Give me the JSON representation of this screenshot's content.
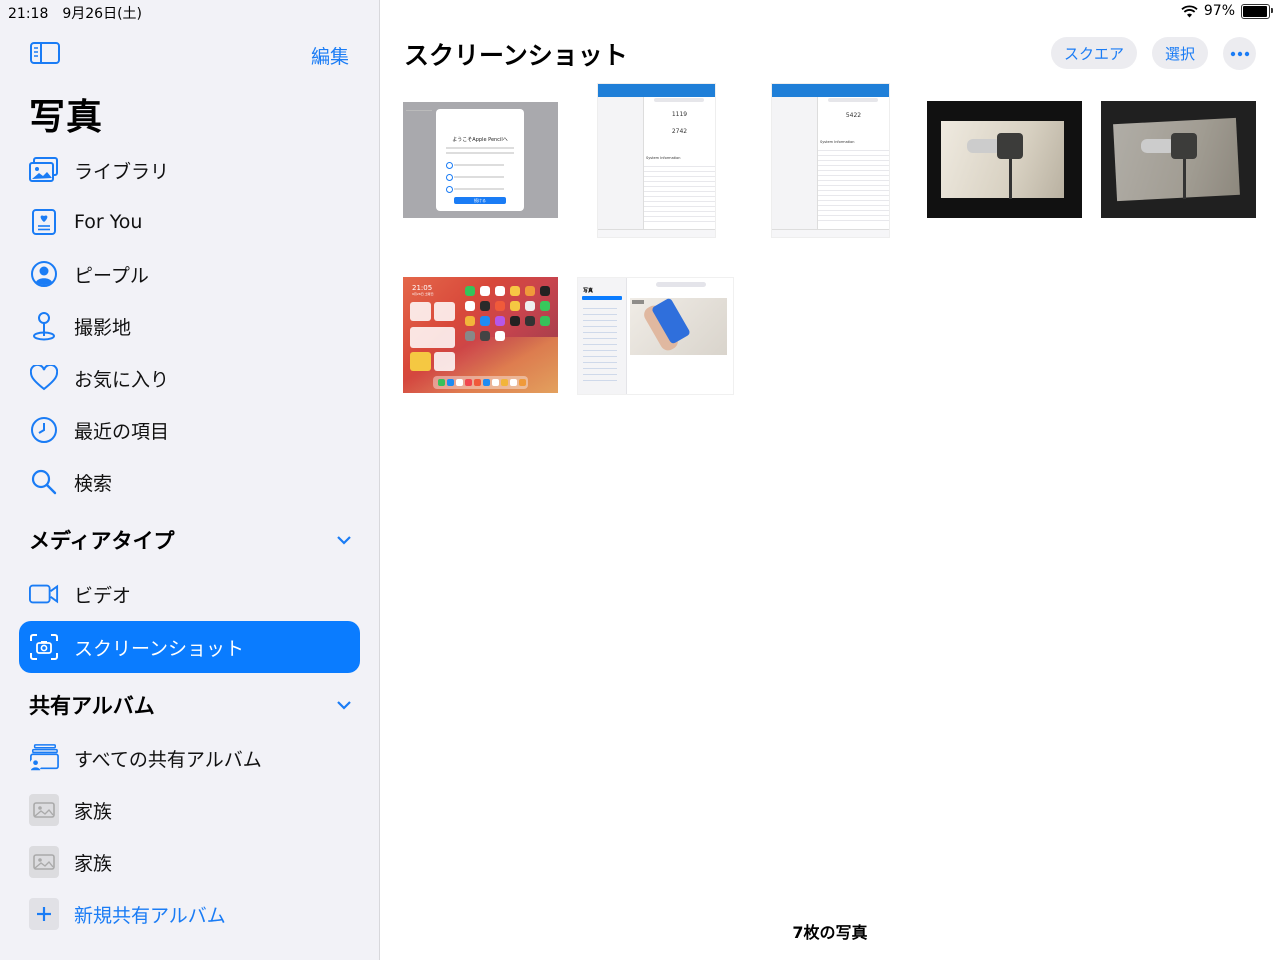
{
  "status_bar": {
    "time_date": "21:18　9月26日(土)",
    "battery_percent": "97%",
    "battery_level": 0.97
  },
  "sidebar": {
    "edit_label": "編集",
    "title": "写真",
    "items": [
      {
        "label": "ライブラリ",
        "icon": "library-icon"
      },
      {
        "label": "For You",
        "icon": "for-you-icon"
      },
      {
        "label": "ピープル",
        "icon": "people-icon"
      },
      {
        "label": "撮影地",
        "icon": "places-icon"
      },
      {
        "label": "お気に入り",
        "icon": "heart-icon"
      },
      {
        "label": "最近の項目",
        "icon": "clock-icon"
      },
      {
        "label": "検索",
        "icon": "search-icon"
      }
    ],
    "media_types": {
      "heading": "メディアタイプ",
      "items": [
        {
          "label": "ビデオ",
          "icon": "video-icon"
        },
        {
          "label": "スクリーンショット",
          "icon": "screenshot-icon",
          "selected": true
        }
      ]
    },
    "shared_albums": {
      "heading": "共有アルバム",
      "items": [
        {
          "label": "すべての共有アルバム",
          "icon": "shared-albums-icon"
        },
        {
          "label": "家族",
          "icon": "album-thumb-icon"
        },
        {
          "label": "家族",
          "icon": "album-thumb-icon"
        },
        {
          "label": "新規共有アルバム",
          "icon": "plus-icon"
        }
      ]
    }
  },
  "main": {
    "title": "スクリーンショット",
    "square_label": "スクエア",
    "select_label": "選択",
    "photo_count": "7枚の写真",
    "photos": {
      "p1": {
        "heading": "ようこそApple Pencilへ",
        "button": "続ける"
      },
      "p2": {
        "score_single": "1119",
        "score_multi": "2742",
        "section": "System Information"
      },
      "p3": {
        "score": "5422",
        "section": "System Information"
      },
      "p6": {
        "time": "21:05",
        "date": "9月26日 土曜日"
      },
      "p7": {
        "title": "写真"
      }
    }
  },
  "colors": {
    "accent": "#0a7cff",
    "sidebar_bg": "#f2f2f7",
    "pill_bg": "#ececf0"
  }
}
